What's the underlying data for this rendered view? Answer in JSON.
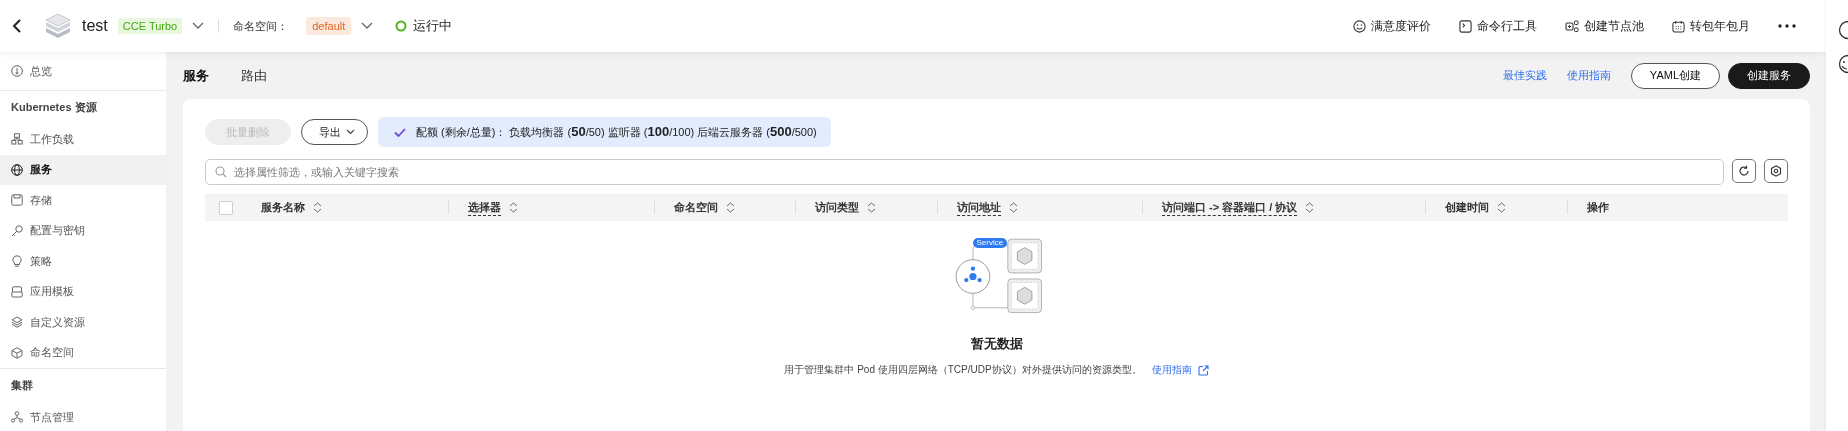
{
  "header": {
    "cluster_name": "test",
    "cluster_type": "CCE Turbo",
    "namespace_label": "命名空间：",
    "namespace": "default",
    "status": "运行中",
    "actions": [
      {
        "kind": "smile",
        "label": "满意度评价"
      },
      {
        "kind": "terminal",
        "label": "命令行工具"
      },
      {
        "kind": "nodes",
        "label": "创建节点池"
      },
      {
        "kind": "calendar",
        "label": "转包年包月"
      }
    ]
  },
  "sidebar": {
    "items": [
      {
        "kind": "item",
        "label": "总览",
        "selected": false
      },
      {
        "kind": "section",
        "label": "Kubernetes 资源"
      },
      {
        "kind": "item",
        "label": "工作负载",
        "selected": false
      },
      {
        "kind": "item",
        "label": "服务",
        "selected": true
      },
      {
        "kind": "item",
        "label": "存储",
        "selected": false
      },
      {
        "kind": "item",
        "label": "配置与密钥",
        "selected": false
      },
      {
        "kind": "item",
        "label": "策略",
        "selected": false
      },
      {
        "kind": "item",
        "label": "应用模板",
        "selected": false
      },
      {
        "kind": "item",
        "label": "自定义资源",
        "selected": false
      },
      {
        "kind": "item",
        "label": "命名空间",
        "selected": false
      },
      {
        "kind": "section",
        "label": "集群"
      },
      {
        "kind": "item",
        "label": "节点管理",
        "selected": false
      }
    ]
  },
  "tabs": [
    {
      "label": "服务",
      "selected": true
    },
    {
      "label": "路由",
      "selected": false
    }
  ],
  "links": [
    "最佳实践",
    "使用指南"
  ],
  "buttons": [
    {
      "label": "YAML创建",
      "primary": false
    },
    {
      "label": "创建服务",
      "primary": true
    }
  ],
  "toolbar": {
    "delete_label": "批量删除",
    "delete_disabled": true,
    "export_label": "导出",
    "quota": "配额 (剩余/总量)：  负载均衡器 (**50**/50) 监听器 (**100**/100) 后端云服务器 (**500**/500)"
  },
  "search": {
    "placeholder": "选择属性筛选，或输入关键字搜索"
  },
  "table": {
    "select_all": {
      "checked": false
    },
    "columns": [
      {
        "label": "服务名称",
        "sortable": true,
        "underlined": false
      },
      {
        "label": "选择器",
        "sortable": true,
        "underlined": true
      },
      {
        "label": "命名空间",
        "sortable": true,
        "underlined": false
      },
      {
        "label": "访问类型",
        "sortable": true,
        "underlined": false
      },
      {
        "label": "访问地址",
        "sortable": true,
        "underlined": true
      },
      {
        "label": "访问端口 -> 容器端口 / 协议",
        "sortable": true,
        "underlined": true
      },
      {
        "label": "创建时间",
        "sortable": true,
        "underlined": false
      },
      {
        "label": "操作",
        "sortable": false,
        "underlined": false
      }
    ]
  },
  "empty": {
    "badge": "Service",
    "title": "暂无数据",
    "description": "用于管理集群中 Pod 使用四层网络（TCP/UDP协议）对外提供访问的资源类型。",
    "link": "使用指南"
  }
}
